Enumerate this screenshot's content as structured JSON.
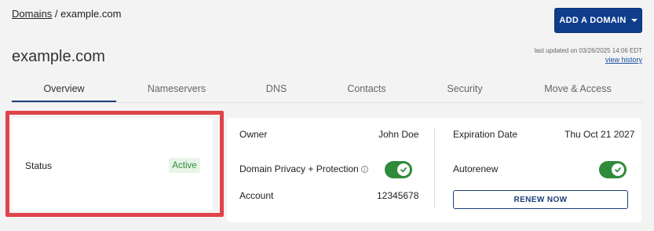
{
  "breadcrumb": {
    "root": "Domains",
    "separator": " / ",
    "current": "example.com"
  },
  "header": {
    "add_domain_label": "ADD A DOMAIN",
    "title": "example.com",
    "last_updated": "last updated on 03/26/2025 14:06 EDT",
    "view_history": "view history"
  },
  "tabs": [
    {
      "label": "Overview",
      "active": true
    },
    {
      "label": "Nameservers",
      "active": false
    },
    {
      "label": "DNS",
      "active": false
    },
    {
      "label": "Contacts",
      "active": false
    },
    {
      "label": "Security",
      "active": false
    },
    {
      "label": "Move & Access",
      "active": false
    }
  ],
  "status_card": {
    "label": "Status",
    "value": "Active"
  },
  "details": {
    "owner_label": "Owner",
    "owner_value": "John Doe",
    "privacy_label": "Domain Privacy + Protection",
    "privacy_enabled": true,
    "account_label": "Account",
    "account_value": "12345678",
    "expiration_label": "Expiration Date",
    "expiration_value": "Thu Oct 21 2027",
    "autorenew_label": "Autorenew",
    "autorenew_enabled": true,
    "renew_label": "RENEW NOW"
  },
  "colors": {
    "primary": "#0f3d8c",
    "toggle_on": "#2f8a3a",
    "status_bg": "#e7f4e7",
    "highlight": "#e0444b"
  }
}
